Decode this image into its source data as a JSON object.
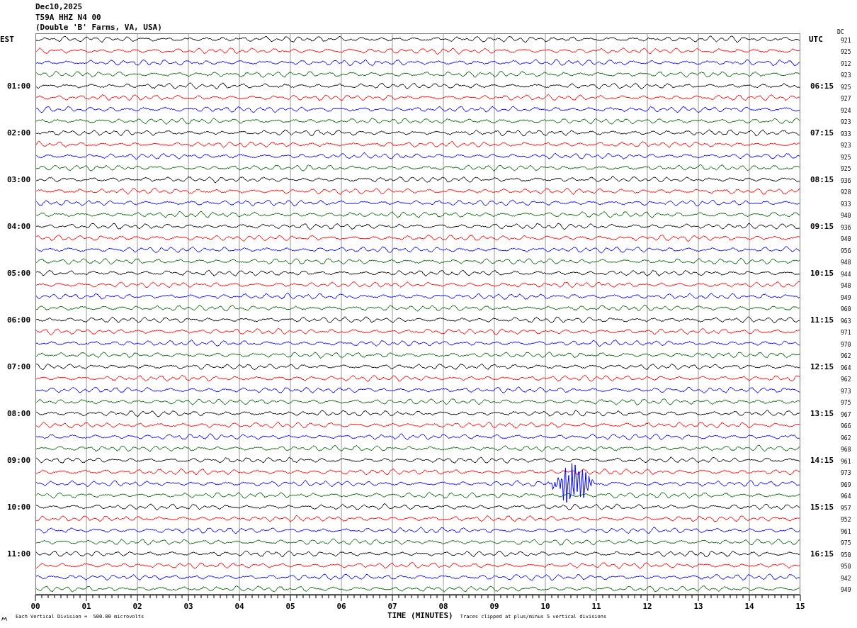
{
  "header": {
    "date": "Dec10,2025",
    "station": "T59A HHZ N4 00",
    "location": "(Double 'B' Farms, VA, USA)"
  },
  "left_zone": "EST",
  "right_zone": "UTC",
  "dc_label": "DC",
  "rows": [
    {
      "color": "#000000",
      "dc": "921"
    },
    {
      "color": "#ff0000",
      "dc": "925"
    },
    {
      "color": "#0000ff",
      "dc": "912"
    },
    {
      "color": "#006400",
      "dc": "923"
    },
    {
      "color": "#000000",
      "left_time": "01:00",
      "right_time": "06:15",
      "dc": "925"
    },
    {
      "color": "#ff0000",
      "dc": "927"
    },
    {
      "color": "#0000ff",
      "dc": "924"
    },
    {
      "color": "#006400",
      "dc": "923"
    },
    {
      "color": "#000000",
      "left_time": "02:00",
      "right_time": "07:15",
      "dc": "933"
    },
    {
      "color": "#ff0000",
      "dc": "923"
    },
    {
      "color": "#0000ff",
      "dc": "925"
    },
    {
      "color": "#006400",
      "dc": "925"
    },
    {
      "color": "#000000",
      "left_time": "03:00",
      "right_time": "08:15",
      "dc": "936"
    },
    {
      "color": "#ff0000",
      "dc": "928"
    },
    {
      "color": "#0000ff",
      "dc": "933"
    },
    {
      "color": "#006400",
      "dc": "940"
    },
    {
      "color": "#000000",
      "left_time": "04:00",
      "right_time": "09:15",
      "dc": "936"
    },
    {
      "color": "#ff0000",
      "dc": "940"
    },
    {
      "color": "#0000ff",
      "dc": "956"
    },
    {
      "color": "#006400",
      "dc": "948"
    },
    {
      "color": "#000000",
      "left_time": "05:00",
      "right_time": "10:15",
      "dc": "944"
    },
    {
      "color": "#ff0000",
      "dc": "948"
    },
    {
      "color": "#0000ff",
      "dc": "949"
    },
    {
      "color": "#006400",
      "dc": "960"
    },
    {
      "color": "#000000",
      "left_time": "06:00",
      "right_time": "11:15",
      "dc": "963"
    },
    {
      "color": "#ff0000",
      "dc": "971"
    },
    {
      "color": "#0000ff",
      "dc": "970"
    },
    {
      "color": "#006400",
      "dc": "962"
    },
    {
      "color": "#000000",
      "left_time": "07:00",
      "right_time": "12:15",
      "dc": "964"
    },
    {
      "color": "#ff0000",
      "dc": "962"
    },
    {
      "color": "#0000ff",
      "dc": "973"
    },
    {
      "color": "#006400",
      "dc": "975"
    },
    {
      "color": "#000000",
      "left_time": "08:00",
      "right_time": "13:15",
      "dc": "967"
    },
    {
      "color": "#ff0000",
      "dc": "966"
    },
    {
      "color": "#0000ff",
      "dc": "962"
    },
    {
      "color": "#006400",
      "dc": "968"
    },
    {
      "color": "#000000",
      "left_time": "09:00",
      "right_time": "14:15",
      "dc": "961"
    },
    {
      "color": "#ff0000",
      "dc": "973"
    },
    {
      "color": "#0000ff",
      "dc": "969"
    },
    {
      "color": "#006400",
      "dc": "964"
    },
    {
      "color": "#000000",
      "left_time": "10:00",
      "right_time": "15:15",
      "dc": "957"
    },
    {
      "color": "#ff0000",
      "dc": "952"
    },
    {
      "color": "#0000ff",
      "dc": "961"
    },
    {
      "color": "#006400",
      "dc": "975"
    },
    {
      "color": "#000000",
      "left_time": "11:00",
      "right_time": "16:15",
      "dc": "950"
    },
    {
      "color": "#ff0000",
      "dc": "950"
    },
    {
      "color": "#0000ff",
      "dc": "942"
    },
    {
      "color": "#006400",
      "dc": "949"
    }
  ],
  "x_axis": {
    "ticks": [
      "00",
      "01",
      "02",
      "03",
      "04",
      "05",
      "06",
      "07",
      "08",
      "09",
      "10",
      "11",
      "12",
      "13",
      "14",
      "15"
    ],
    "title": "TIME (MINUTES)"
  },
  "footer": {
    "scale": "Each Vertical Division =  500.00 microvolts",
    "clip": "Traces clipped at plus/minus 5 vertical divisions"
  }
}
